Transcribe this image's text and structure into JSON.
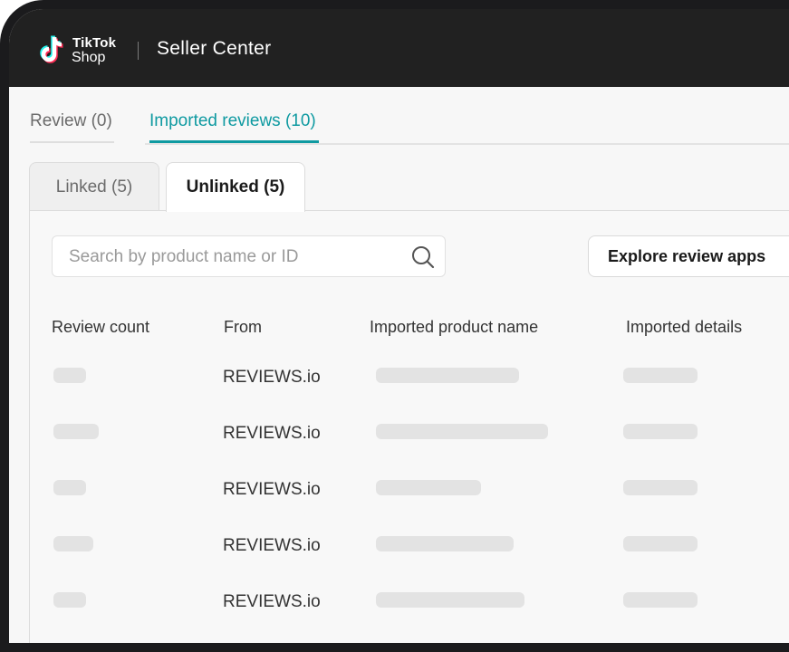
{
  "header": {
    "logo_line1": "TikTok",
    "logo_line2": "Shop",
    "app_title": "Seller Center"
  },
  "tabs": [
    {
      "label": "Review (0)",
      "active": false
    },
    {
      "label": "Imported reviews (10)",
      "active": true
    }
  ],
  "subtabs": [
    {
      "label": "Linked (5)",
      "active": false
    },
    {
      "label": "Unlinked (5)",
      "active": true
    }
  ],
  "search": {
    "placeholder": "Search by product name or ID",
    "value": ""
  },
  "explore_button": "Explore review apps",
  "table": {
    "columns": [
      "Review count",
      "From",
      "Imported product name",
      "Imported details"
    ],
    "rows": [
      {
        "from": "REVIEWS.io"
      },
      {
        "from": "REVIEWS.io"
      },
      {
        "from": "REVIEWS.io"
      },
      {
        "from": "REVIEWS.io"
      },
      {
        "from": "REVIEWS.io"
      }
    ]
  },
  "colors": {
    "accent": "#0f9aa1",
    "topbar": "#212121",
    "skeleton": "#e3e3e3"
  },
  "icons": [
    "tiktok-logo-icon",
    "search-icon"
  ]
}
